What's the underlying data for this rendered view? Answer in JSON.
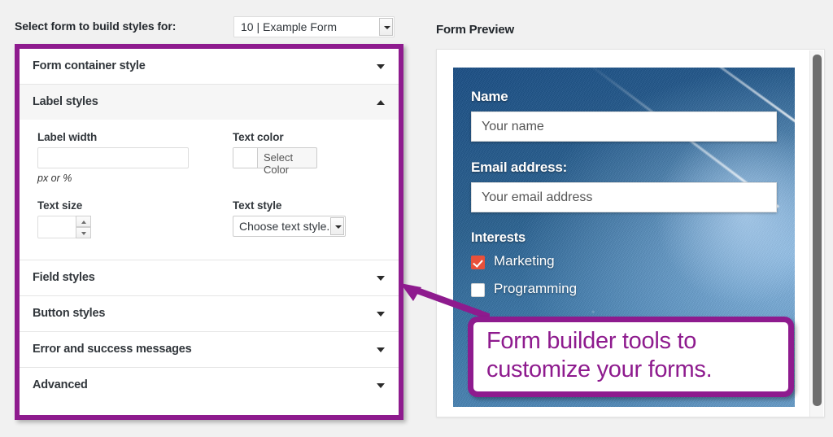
{
  "page": {
    "background_color": "#f1f1f1",
    "accent_color": "#8e1b8e"
  },
  "topbar": {
    "select_label": "Select form to build styles for:",
    "form_select": {
      "value": "10 | Example Form",
      "arrow_icon": "chevron-down-icon"
    }
  },
  "styles_panel": {
    "border_color": "#8e1b8e",
    "sections": [
      {
        "title": "Form container style",
        "state": "collapsed",
        "arrow_icon": "chevron-down-icon"
      },
      {
        "title": "Label styles",
        "state": "expanded",
        "arrow_icon": "chevron-up-icon"
      },
      {
        "title": "Field styles",
        "state": "collapsed",
        "arrow_icon": "chevron-down-icon"
      },
      {
        "title": "Button styles",
        "state": "collapsed",
        "arrow_icon": "chevron-down-icon"
      },
      {
        "title": "Error and success messages",
        "state": "collapsed",
        "arrow_icon": "chevron-down-icon"
      },
      {
        "title": "Advanced",
        "state": "collapsed",
        "arrow_icon": "chevron-down-icon"
      }
    ],
    "label_styles_fields": {
      "label_width": {
        "label": "Label width",
        "value": "",
        "placeholder": "",
        "hint": "px or %"
      },
      "text_color": {
        "label": "Text color",
        "button_label": "Select Color",
        "swatch_color": "#ffffff"
      },
      "text_size": {
        "label": "Text size",
        "value": "",
        "stepper_up_icon": "caret-up-icon",
        "stepper_down_icon": "caret-down-icon"
      },
      "text_style": {
        "label": "Text style",
        "value": "Choose text style..",
        "arrow_icon": "chevron-down-icon"
      }
    }
  },
  "preview": {
    "heading": "Form Preview",
    "form": {
      "fields": [
        {
          "label": "Name",
          "placeholder": "Your name"
        },
        {
          "label": "Email address:",
          "placeholder": "Your email address"
        }
      ],
      "group": {
        "label": "Interests",
        "options": [
          {
            "label": "Marketing",
            "checked": true,
            "check_color": "#e8503a"
          },
          {
            "label": "Programming",
            "checked": false
          }
        ]
      }
    },
    "scrollbar": {
      "thumb_color": "#6e6e6e"
    }
  },
  "callout": {
    "text": "Form builder tools to customize your forms.",
    "border_color": "#8e1b8e",
    "text_color": "#8e1b8e",
    "arrow_icon": "arrow-pointer-icon"
  }
}
